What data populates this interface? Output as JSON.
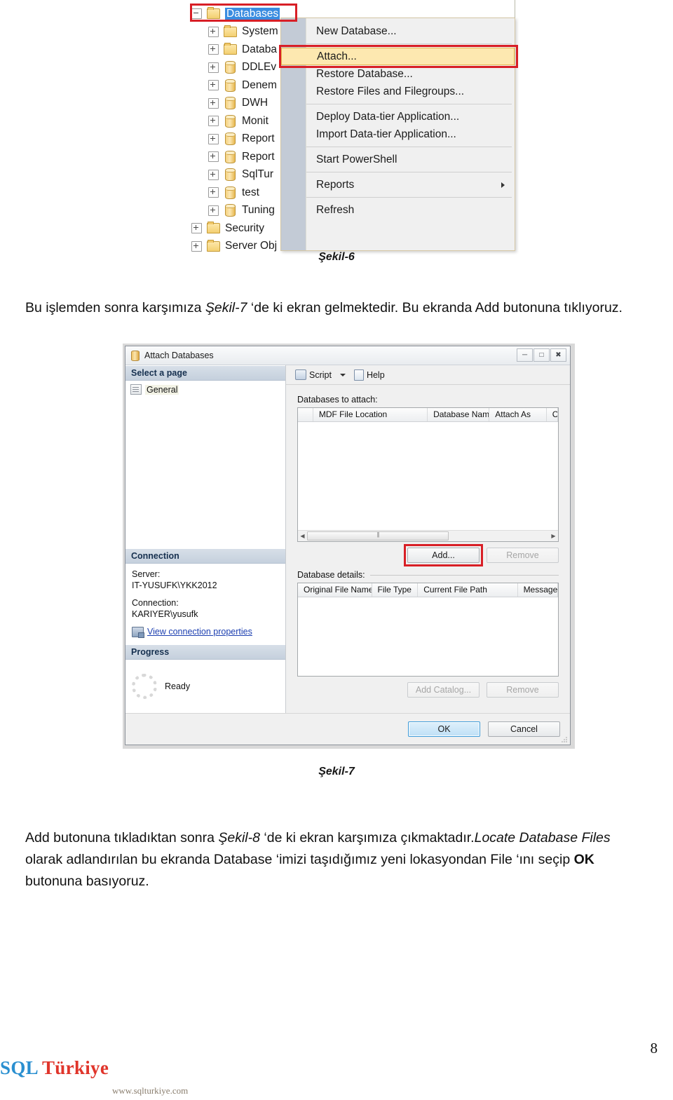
{
  "figure6": {
    "caption": "Şekil-6",
    "tree": {
      "nodes": [
        {
          "label": "Databases",
          "icon": "folder-icon",
          "expander": "minus",
          "indent": 0,
          "selected": true
        },
        {
          "label": "System",
          "icon": "folder-icon",
          "expander": "plus",
          "indent": 1,
          "selected": false
        },
        {
          "label": "Databa",
          "icon": "folder-icon",
          "expander": "plus",
          "indent": 1,
          "selected": false
        },
        {
          "label": "DDLEv",
          "icon": "database-icon",
          "expander": "plus",
          "indent": 1,
          "selected": false
        },
        {
          "label": "Denem",
          "icon": "database-icon",
          "expander": "plus",
          "indent": 1,
          "selected": false
        },
        {
          "label": "DWH",
          "icon": "database-icon",
          "expander": "plus",
          "indent": 1,
          "selected": false
        },
        {
          "label": "Monit",
          "icon": "database-icon",
          "expander": "plus",
          "indent": 1,
          "selected": false
        },
        {
          "label": "Report",
          "icon": "database-icon",
          "expander": "plus",
          "indent": 1,
          "selected": false
        },
        {
          "label": "Report",
          "icon": "database-icon",
          "expander": "plus",
          "indent": 1,
          "selected": false
        },
        {
          "label": "SqlTur",
          "icon": "database-icon",
          "expander": "plus",
          "indent": 1,
          "selected": false
        },
        {
          "label": "test",
          "icon": "database-icon",
          "expander": "plus",
          "indent": 1,
          "selected": false
        },
        {
          "label": "Tuning",
          "icon": "database-icon",
          "expander": "plus",
          "indent": 1,
          "selected": false
        },
        {
          "label": "Security",
          "icon": "folder-icon",
          "expander": "plus",
          "indent": 0,
          "selected": false
        },
        {
          "label": "Server Obj",
          "icon": "folder-icon",
          "expander": "plus",
          "indent": 0,
          "selected": false
        }
      ]
    },
    "context_menu": {
      "items": [
        {
          "label": "New Database...",
          "highlighted": false,
          "submenu": false
        },
        {
          "label": "Attach...",
          "highlighted": true,
          "submenu": false
        },
        {
          "label": "Restore Database...",
          "highlighted": false,
          "submenu": false
        },
        {
          "label": "Restore Files and Filegroups...",
          "highlighted": false,
          "submenu": false
        },
        {
          "label": "Deploy Data-tier Application...",
          "highlighted": false,
          "submenu": false
        },
        {
          "label": "Import Data-tier Application...",
          "highlighted": false,
          "submenu": false
        },
        {
          "label": "Start PowerShell",
          "highlighted": false,
          "submenu": false
        },
        {
          "label": "Reports",
          "highlighted": false,
          "submenu": true
        },
        {
          "label": "Refresh",
          "highlighted": false,
          "submenu": false
        }
      ]
    },
    "highlight_color": "#d81f26"
  },
  "paragraph1": {
    "part1": "Bu işlemden sonra karşımıza ",
    "em1": "Şekil-7",
    "part2": " ‘de ki ekran gelmektedir. Bu ekranda Add butonuna tıklıyoruz."
  },
  "figure7": {
    "caption": "Şekil-7",
    "dialog": {
      "title": "Attach Databases",
      "window_buttons": [
        "minimize",
        "maximize",
        "close"
      ],
      "left_pane": {
        "select_page_header": "Select a page",
        "pages": [
          "General"
        ],
        "connection_header": "Connection",
        "server_label": "Server:",
        "server_value": "IT-YUSUFK\\YKK2012",
        "connection_label": "Connection:",
        "connection_value": "KARIYER\\yusufk",
        "view_connection_properties": "View connection properties",
        "progress_header": "Progress",
        "progress_status": "Ready"
      },
      "toolbar": {
        "script_label": "Script",
        "help_label": "Help"
      },
      "attach_section": {
        "label": "Databases to attach:",
        "columns": [
          "MDF File Location",
          "Database Name",
          "Attach As",
          "C"
        ],
        "rows": [],
        "add_button": "Add...",
        "remove_button": "Remove",
        "add_button_highlighted": true,
        "remove_button_disabled": true
      },
      "details_section": {
        "label": "Database details:",
        "columns": [
          "Original File Name",
          "File Type",
          "Current File Path",
          "Message"
        ],
        "rows": [],
        "add_catalog_button": "Add Catalog...",
        "remove_button": "Remove",
        "add_catalog_disabled": true,
        "remove_disabled": true
      },
      "footer": {
        "ok_button": "OK",
        "cancel_button": "Cancel"
      }
    },
    "highlight_color": "#d81f26"
  },
  "paragraph2": {
    "part1": "Add butonuna tıkladıktan sonra ",
    "em1": "Şekil-8",
    "part2": " ‘de ki ekran karşımıza çıkmaktadır.",
    "em2": "Locate Database Files",
    "part3": " olarak adlandırılan bu ekranda Database ‘imizi taşıdığımız yeni lokasyondan File ‘ını seçip ",
    "strong1": "OK",
    "part4": " butonuna basıyoruz."
  },
  "footer": {
    "page_number": "8",
    "logo_primary": "SQL",
    "logo_secondary": "Türkiye",
    "website": "www.sqlturkiye.com",
    "logo_primary_color": "#2a8fd0",
    "logo_secondary_color": "#e0352b"
  }
}
